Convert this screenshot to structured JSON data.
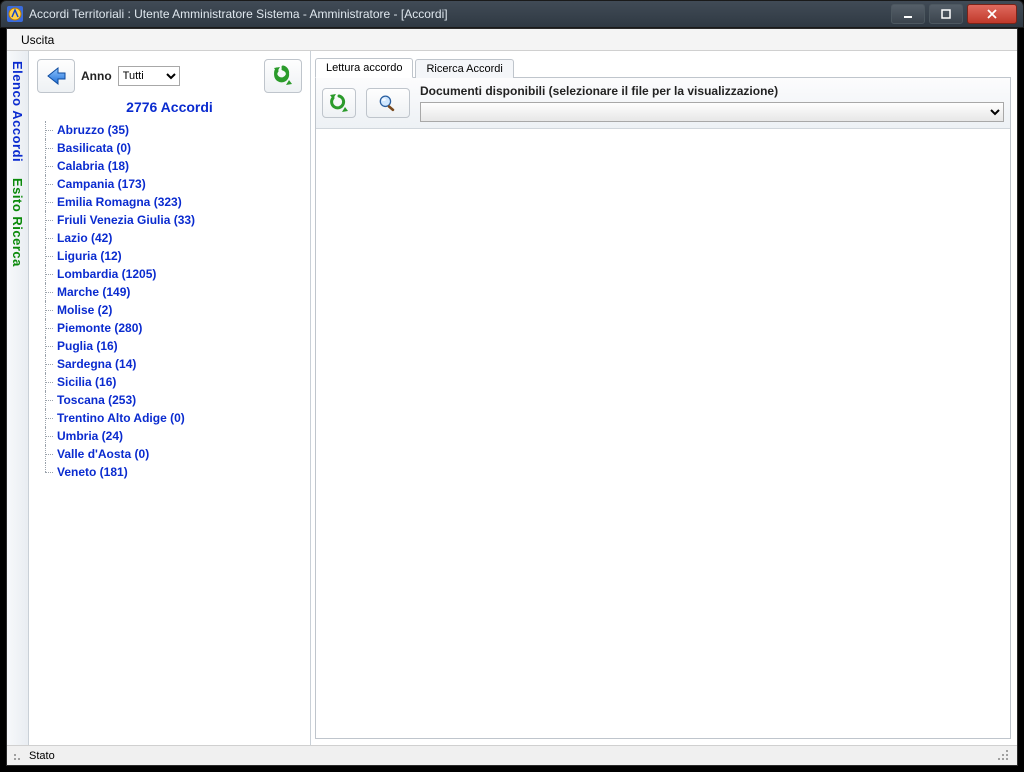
{
  "window": {
    "title": "Accordi Territoriali : Utente Amministratore Sistema - Amministratore - [Accordi]"
  },
  "menu": {
    "exit": "Uscita"
  },
  "sidebar_tabs": {
    "list": "Elenco Accordi",
    "results": "Esito Ricerca"
  },
  "left": {
    "year_label": "Anno",
    "year_value": "Tutti",
    "count_text": "2776 Accordi",
    "regions": [
      {
        "label": "Abruzzo (35)"
      },
      {
        "label": "Basilicata (0)"
      },
      {
        "label": "Calabria (18)"
      },
      {
        "label": "Campania (173)"
      },
      {
        "label": "Emilia Romagna (323)"
      },
      {
        "label": "Friuli Venezia Giulia (33)"
      },
      {
        "label": "Lazio (42)"
      },
      {
        "label": "Liguria (12)"
      },
      {
        "label": "Lombardia (1205)"
      },
      {
        "label": "Marche (149)"
      },
      {
        "label": "Molise (2)"
      },
      {
        "label": "Piemonte (280)"
      },
      {
        "label": "Puglia (16)"
      },
      {
        "label": "Sardegna (14)"
      },
      {
        "label": "Sicilia (16)"
      },
      {
        "label": "Toscana (253)"
      },
      {
        "label": "Trentino Alto Adige (0)"
      },
      {
        "label": "Umbria (24)"
      },
      {
        "label": "Valle d'Aosta (0)"
      },
      {
        "label": "Veneto (181)"
      }
    ]
  },
  "tabs": {
    "read": "Lettura accordo",
    "search": "Ricerca Accordi"
  },
  "docs": {
    "header": "Documenti disponibili (selezionare il file per la visualizzazione)"
  },
  "status": {
    "text": "Stato"
  }
}
